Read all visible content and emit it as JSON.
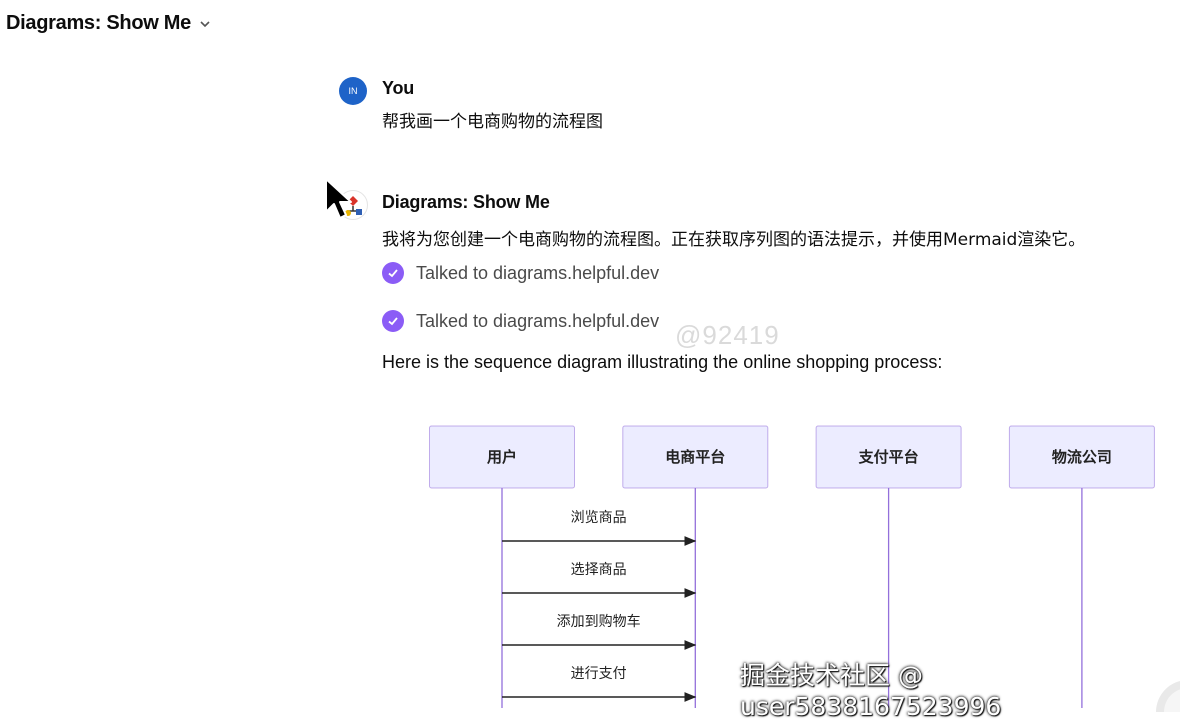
{
  "header": {
    "title": "Diagrams: Show Me"
  },
  "conversation": {
    "user": {
      "avatar_initials": "IN",
      "name": "You",
      "message": "帮我画一个电商购物的流程图"
    },
    "assistant": {
      "name": "Diagrams: Show Me",
      "intro": "我将为您创建一个电商购物的流程图。正在获取序列图的语法提示，并使用Mermaid渲染它。",
      "tool_calls": [
        {
          "label": "Talked to diagrams.helpful.dev"
        },
        {
          "label": "Talked to diagrams.helpful.dev"
        }
      ],
      "followup": "Here is the sequence diagram illustrating the online shopping process:"
    }
  },
  "sequence_diagram": {
    "participants": [
      "用户",
      "电商平台",
      "支付平台",
      "物流公司"
    ],
    "messages": [
      {
        "from": "用户",
        "to": "电商平台",
        "label": "浏览商品"
      },
      {
        "from": "用户",
        "to": "电商平台",
        "label": "选择商品"
      },
      {
        "from": "用户",
        "to": "电商平台",
        "label": "添加到购物车"
      },
      {
        "from": "用户",
        "to": "电商平台",
        "label": "进行支付"
      }
    ],
    "colors": {
      "participant_fill": "#ECECFF",
      "participant_stroke": "#9370DB",
      "lifeline": "#9370DB",
      "arrow": "#222222"
    }
  },
  "watermarks": {
    "center": "@92419",
    "corner": "掘金技术社区 @ user5838167523996"
  },
  "colors": {
    "accent_check": "#8B5CF6",
    "user_avatar": "#1E63C8"
  }
}
